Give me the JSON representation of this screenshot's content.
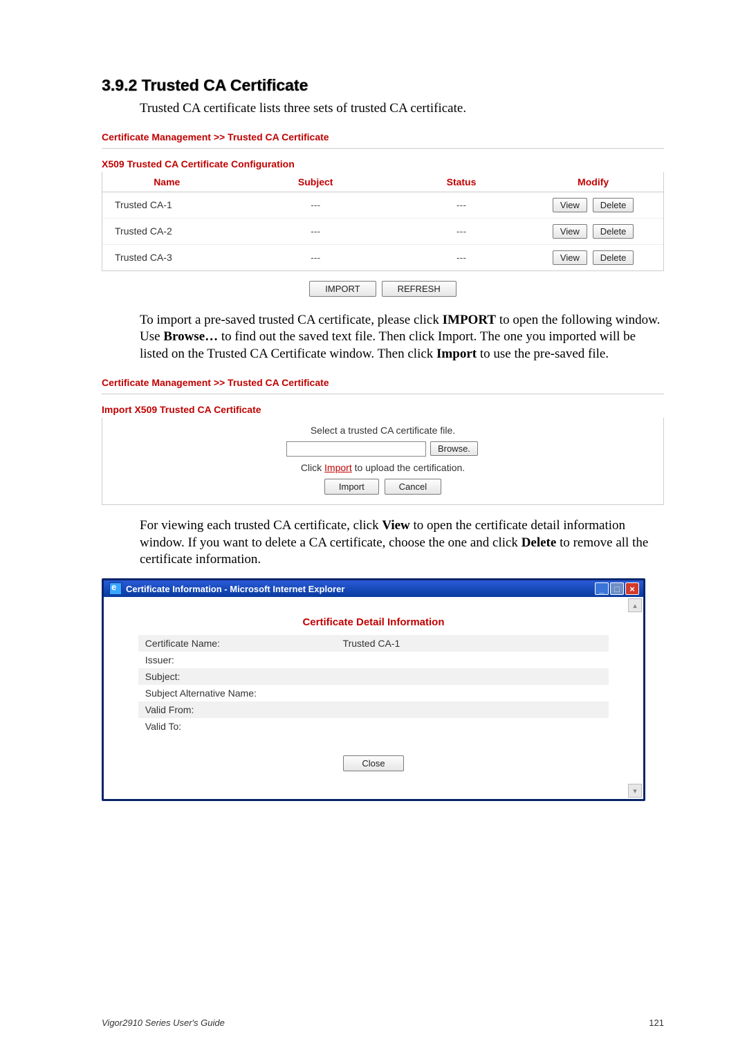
{
  "heading": "3.9.2 Trusted CA Certificate",
  "intro": "Trusted CA certificate lists three sets of trusted CA certificate.",
  "fig1": {
    "breadcrumb": "Certificate Management >> Trusted CA Certificate",
    "tableTitle": "X509 Trusted CA Certificate Configuration",
    "headers": {
      "name": "Name",
      "subject": "Subject",
      "status": "Status",
      "modify": "Modify"
    },
    "rows": [
      {
        "name": "Trusted CA-1",
        "subject": "---",
        "status": "---",
        "view": "View",
        "delete": "Delete"
      },
      {
        "name": "Trusted CA-2",
        "subject": "---",
        "status": "---",
        "view": "View",
        "delete": "Delete"
      },
      {
        "name": "Trusted CA-3",
        "subject": "---",
        "status": "---",
        "view": "View",
        "delete": "Delete"
      }
    ],
    "importBtn": "IMPORT",
    "refreshBtn": "REFRESH"
  },
  "para_import_pre": "To import a pre-saved trusted CA certificate, please click ",
  "para_import_bold1": "IMPORT",
  "para_import_mid1": " to open the following window. Use ",
  "para_import_bold2": "Browse…",
  "para_import_mid2": " to find out the saved text file. Then click Import. The one you imported will be listed on the Trusted CA Certificate window. Then click ",
  "para_import_bold3": "Import",
  "para_import_post": " to use the pre-saved file.",
  "fig2": {
    "breadcrumb": "Certificate Management >> Trusted CA Certificate",
    "tableTitle": "Import X509 Trusted CA Certificate",
    "line1": "Select a trusted CA certificate file.",
    "browseBtn": "Browse.",
    "line2a": "Click ",
    "line2link": "Import",
    "line2b": " to upload the certification.",
    "importBtn": "Import",
    "cancelBtn": "Cancel"
  },
  "para_view_pre": "For viewing each trusted CA certificate, click ",
  "para_view_bold1": "View",
  "para_view_mid": " to open the certificate detail information window. If you want to delete a CA certificate, choose the one and click ",
  "para_view_bold2": "Delete",
  "para_view_post": " to remove all the certificate information.",
  "popup": {
    "title": "Certificate Information - Microsoft Internet Explorer",
    "heading": "Certificate Detail Information",
    "rows": [
      {
        "k": "Certificate Name:",
        "v": "Trusted CA-1"
      },
      {
        "k": "Issuer:",
        "v": ""
      },
      {
        "k": "Subject:",
        "v": ""
      },
      {
        "k": "Subject Alternative Name:",
        "v": ""
      },
      {
        "k": "Valid From:",
        "v": ""
      },
      {
        "k": "Valid To:",
        "v": ""
      }
    ],
    "closeBtn": "Close"
  },
  "footer": {
    "guide": "Vigor2910 Series User's Guide",
    "page": "121"
  }
}
